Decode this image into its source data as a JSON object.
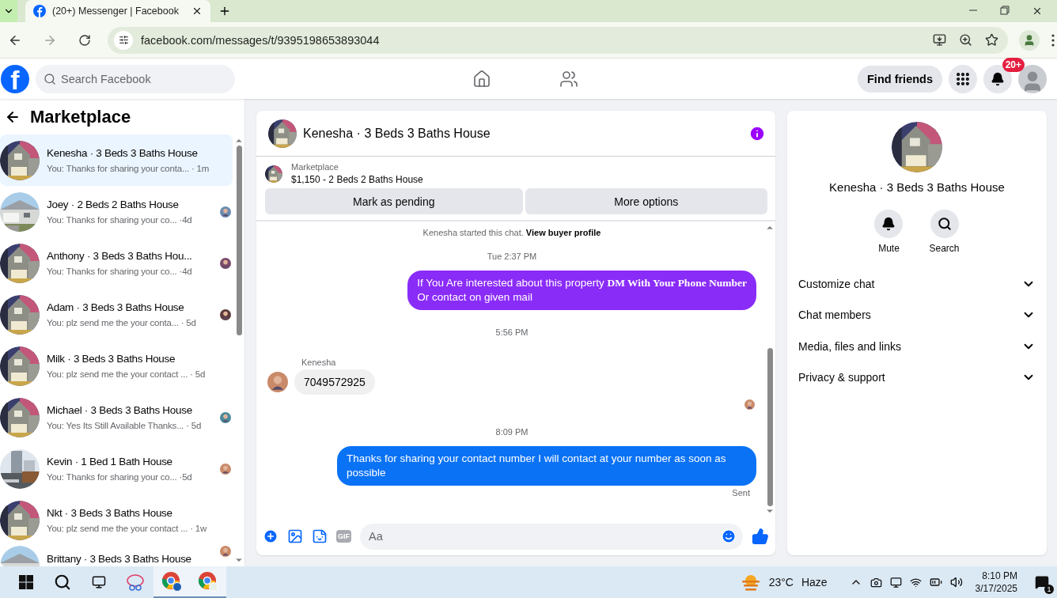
{
  "browser": {
    "tab_title": "(20+) Messenger | Facebook",
    "url": "facebook.com/messages/t/9395198653893044"
  },
  "header": {
    "logo": "f",
    "search_placeholder": "Search Facebook",
    "find_friends": "Find friends",
    "notification_badge": "20+"
  },
  "sidebar": {
    "title": "Marketplace",
    "conversations": [
      {
        "name": "Kenesha · 3 Beds 3 Baths House",
        "preview": "You: Thanks for sharing your conta...",
        "time": "· 1m",
        "selected": true,
        "seen": false
      },
      {
        "name": "Joey · 2 Beds 2 Baths House",
        "preview": "You: Thanks for sharing your co...",
        "time": "·4d",
        "selected": false,
        "seen": true
      },
      {
        "name": "Anthony · 3 Beds 3 Baths Hou...",
        "preview": "You: Thanks for sharing your co...",
        "time": "·4d",
        "selected": false,
        "seen": true
      },
      {
        "name": "Adam · 3 Beds 3 Baths House",
        "preview": "You: plz send me the your conta...",
        "time": "· 5d",
        "selected": false,
        "seen": true
      },
      {
        "name": "Milk · 3 Beds 3 Baths House",
        "preview": "You: plz send me the your contact ...",
        "time": "· 5d",
        "selected": false,
        "seen": false
      },
      {
        "name": "Michael · 3 Beds 3 Baths House",
        "preview": "You: Yes Its Still Available Thanks...",
        "time": "· 5d",
        "selected": false,
        "seen": true
      },
      {
        "name": "Kevin · 1 Bed 1 Bath House",
        "preview": "You: Thanks for sharing your co...",
        "time": "·5d",
        "selected": false,
        "seen": true
      },
      {
        "name": "Nkt · 3 Beds 3 Baths House",
        "preview": "You: plz send me the your contact ...",
        "time": "· 1w",
        "selected": false,
        "seen": false
      },
      {
        "name": "Brittany · 3 Beds 3 Baths House",
        "selected": false,
        "seen": true
      }
    ]
  },
  "chat": {
    "title": "Kenesha · 3 Beds 3 Baths House",
    "listing": {
      "label": "Marketplace",
      "item": "$1,150 - 2 Beds 2 Baths House",
      "buttons": [
        "Mark as pending",
        "More options"
      ]
    },
    "messages": [
      {
        "kind": "system",
        "text": "Kenesha started this chat.",
        "link": "View buyer profile"
      },
      {
        "kind": "timestamp",
        "text": "Tue 2:37 PM"
      },
      {
        "kind": "outgoing",
        "color": "#8a2cf8",
        "text": "If You Are interested about this property  **DM With Your Phone Number**\nOr contact on given mail"
      },
      {
        "kind": "timestamp",
        "text": "5:56 PM"
      },
      {
        "kind": "incoming",
        "sender": "Kenesha",
        "text": "7049572925"
      },
      {
        "kind": "seen"
      },
      {
        "kind": "timestamp",
        "text": "8:09 PM"
      },
      {
        "kind": "outgoing",
        "color": "#0a72f5",
        "text": "Thanks for sharing your contact number I will contact at your number as soon as possible",
        "status": "Sent"
      }
    ],
    "composer": {
      "gif_label": "GIF",
      "placeholder": "Aa"
    }
  },
  "info_panel": {
    "title": "Kenesha · 3 Beds 3 Baths House",
    "actions": [
      {
        "kind": "mute",
        "label": "Mute"
      },
      {
        "kind": "search",
        "label": "Search"
      }
    ],
    "sections": [
      {
        "label": "Customize chat",
        "expanded": false
      },
      {
        "label": "Chat members",
        "expanded": false
      },
      {
        "label": "Media, files and links",
        "expanded": false
      },
      {
        "label": "Privacy & support",
        "expanded": false
      }
    ]
  },
  "taskbar": {
    "temperature": "23°C",
    "weather": "Haze",
    "time": "8:10 PM",
    "date": "3/17/2025",
    "notification_count": "1"
  }
}
